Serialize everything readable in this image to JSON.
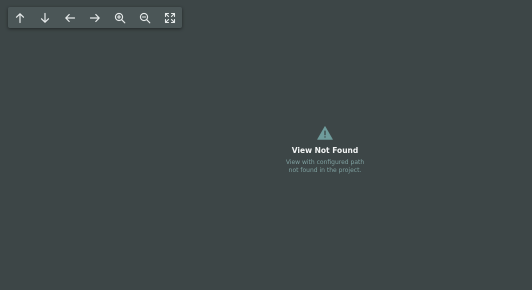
{
  "toolbar": {
    "buttons": [
      {
        "icon": "arrow-up-icon"
      },
      {
        "icon": "arrow-down-icon"
      },
      {
        "icon": "arrow-left-icon"
      },
      {
        "icon": "arrow-right-icon"
      },
      {
        "icon": "zoom-in-icon"
      },
      {
        "icon": "zoom-out-icon"
      },
      {
        "icon": "fullscreen-icon"
      }
    ]
  },
  "message": {
    "icon": "warning-icon",
    "title": "View Not Found",
    "description": "View with configured path\nnot found in the project."
  },
  "colors": {
    "background": "#3d4647",
    "toolbar": "#4b5657",
    "icon": "#e6eaea",
    "warning": "#6f9c9c",
    "title": "#f2f4f4",
    "description": "#7fa0a0"
  }
}
